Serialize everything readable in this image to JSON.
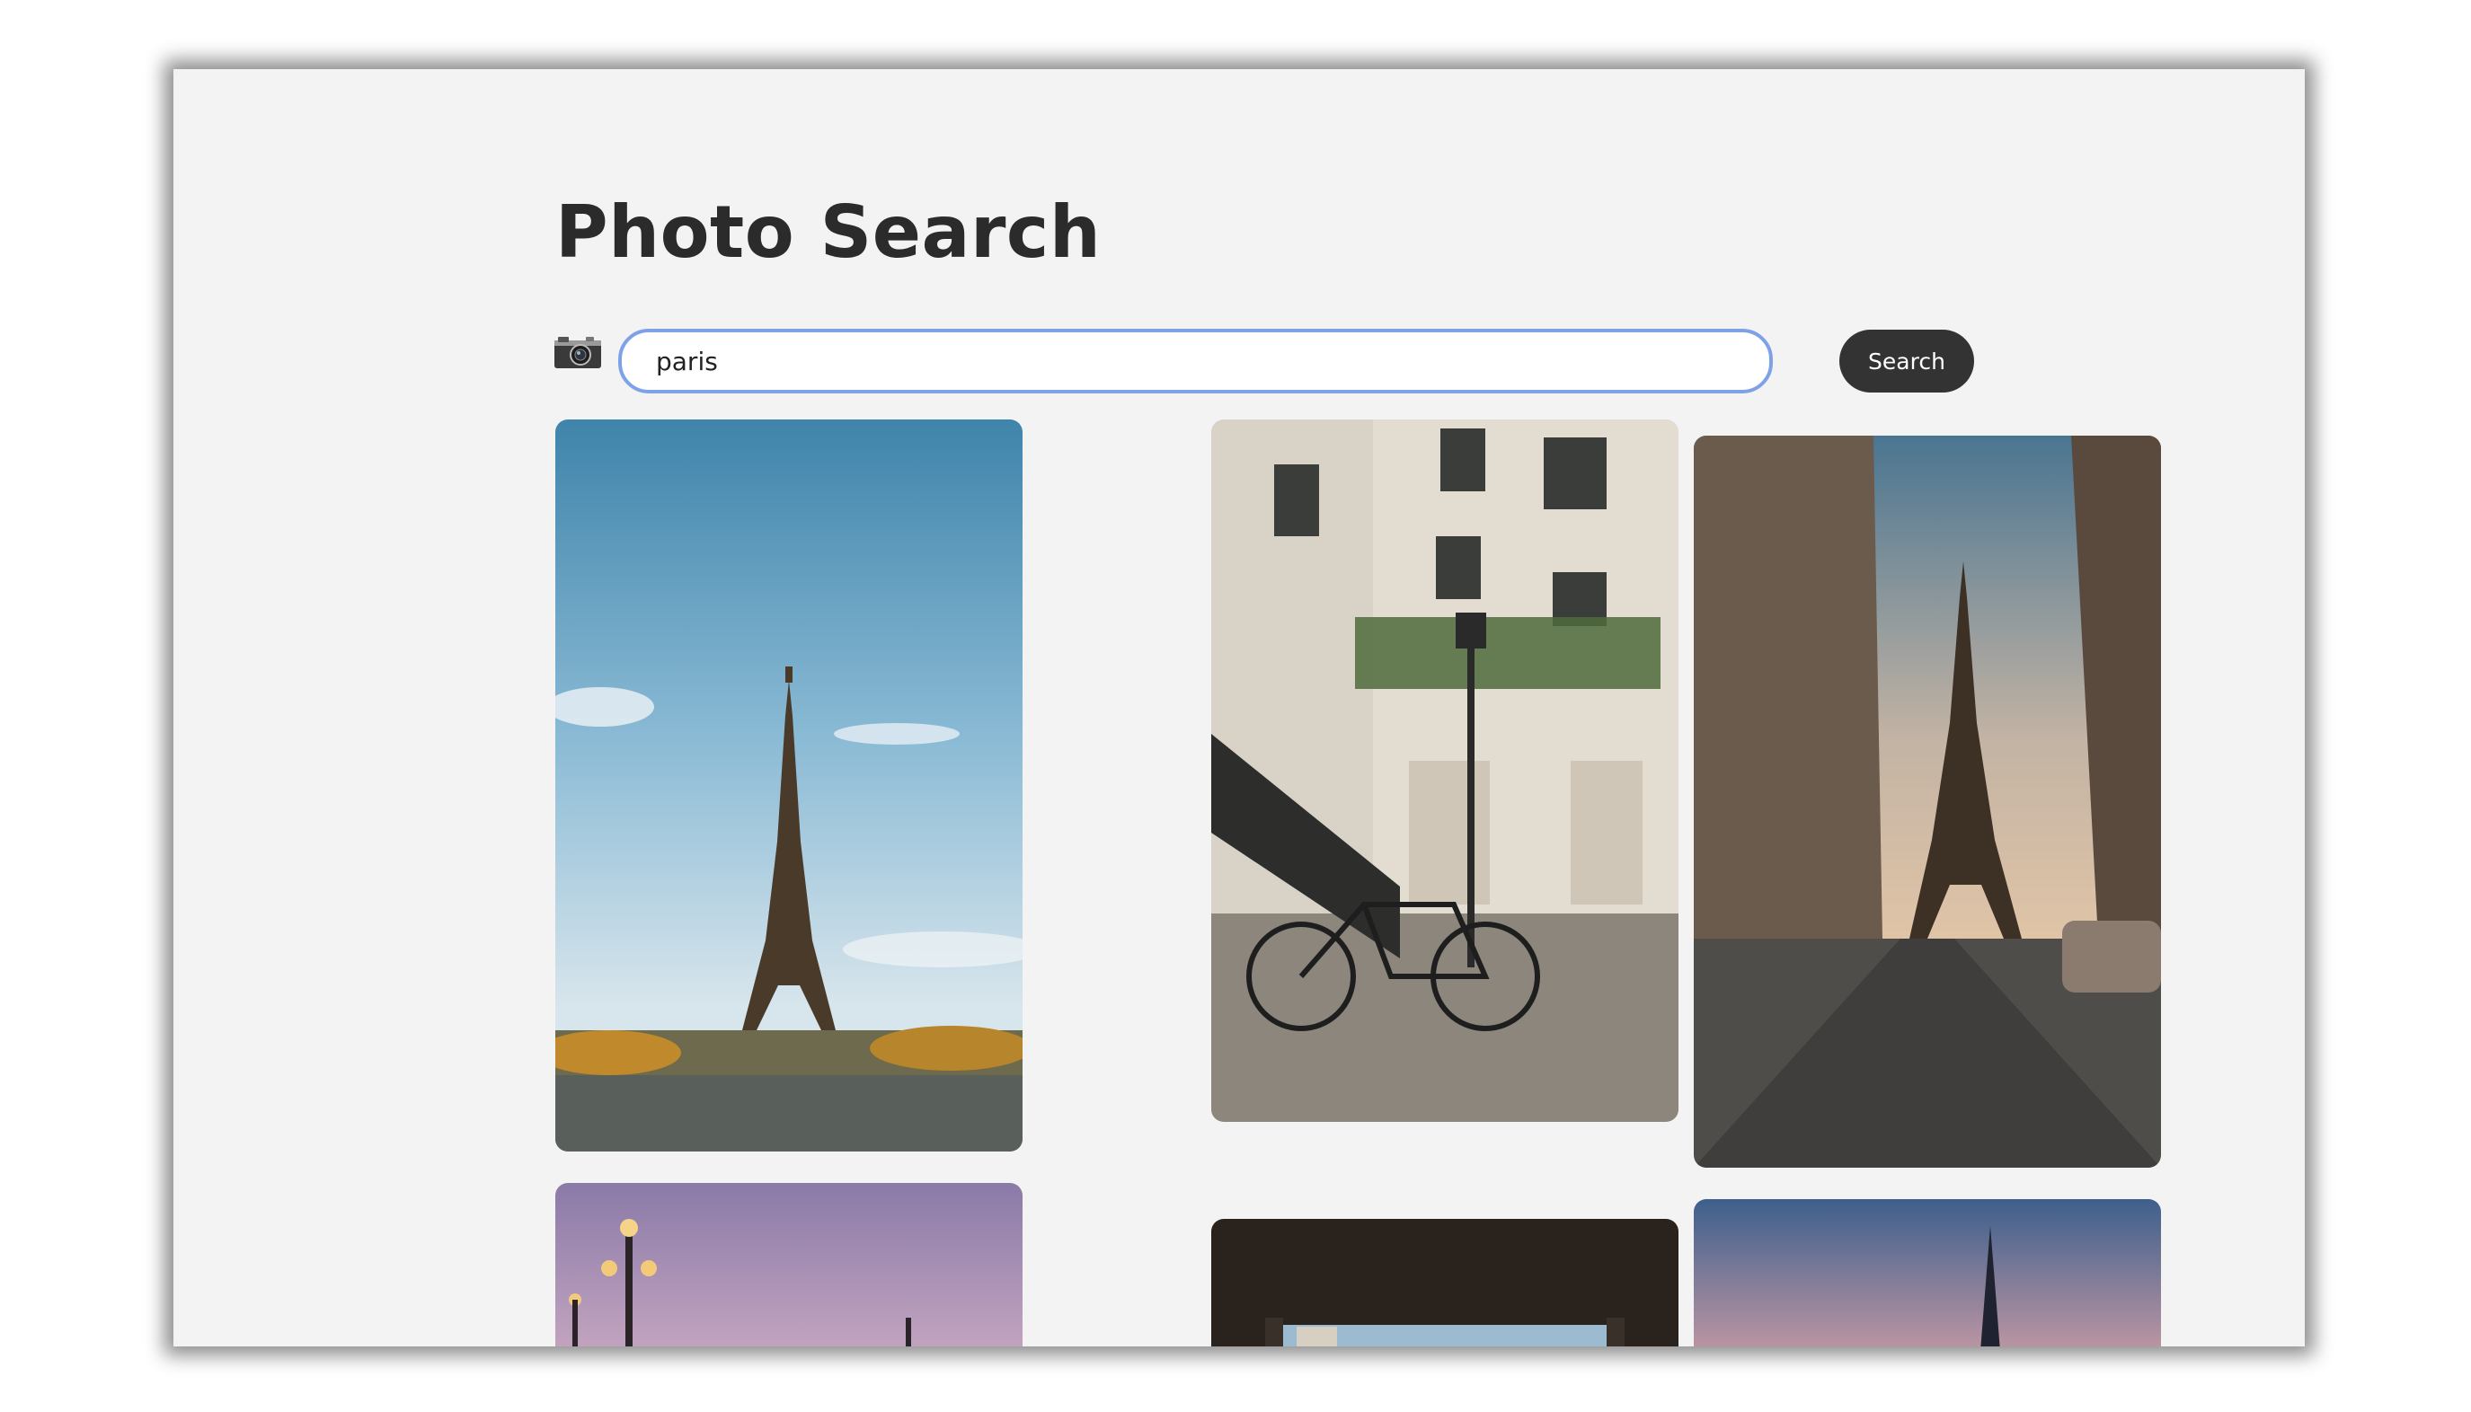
{
  "page": {
    "title": "Photo Search"
  },
  "search": {
    "value": "paris",
    "button_label": "Search"
  },
  "results": [
    {
      "subject": "Eiffel Tower under blue sky"
    },
    {
      "subject": "Bicycle by lamp post in front of Parisian building"
    },
    {
      "subject": "Cobblestone street leading to Eiffel Tower"
    },
    {
      "subject": "Ornate bridge lamps at dusk"
    },
    {
      "subject": "View through open window"
    },
    {
      "subject": "Eiffel Tower at sunset"
    }
  ],
  "colors": {
    "accent_border": "#7ea2e8",
    "button_bg": "#333333",
    "background": "#f3f3f3"
  }
}
